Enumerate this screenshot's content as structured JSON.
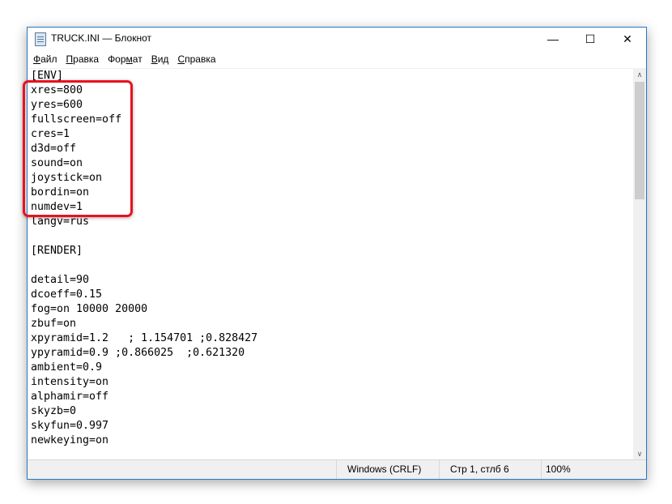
{
  "window": {
    "title": "TRUCK.INI — Блокнот",
    "icon": "notepad-icon"
  },
  "controls": {
    "minimize": "—",
    "maximize": "☐",
    "close": "✕"
  },
  "menu": [
    {
      "u": "Ф",
      "rest": "айл"
    },
    {
      "u": "П",
      "rest": "равка"
    },
    {
      "pre": "Фор",
      "u": "м",
      "rest": "ат"
    },
    {
      "u": "В",
      "rest": "ид"
    },
    {
      "u": "С",
      "rest": "правка"
    }
  ],
  "lines": [
    "[ENV]",
    "xres=800",
    "yres=600",
    "fullscreen=off",
    "cres=1",
    "d3d=off",
    "sound=on",
    "joystick=on",
    "bordin=on",
    "numdev=1",
    "langv=rus",
    "",
    "[RENDER]",
    "",
    "detail=90",
    "dcoeff=0.15",
    "fog=on 10000 20000",
    "zbuf=on",
    "xpyramid=1.2   ; 1.154701 ;0.828427",
    "ypyramid=0.9 ;0.866025  ;0.621320",
    "ambient=0.9",
    "intensity=on",
    "alphamir=off",
    "skyzb=0",
    "skyfun=0.997",
    "newkeying=on"
  ],
  "status": {
    "eol": "Windows (CRLF)",
    "position": "Стр 1, стлб 6",
    "zoom": "100%"
  },
  "highlight_color": "#e8121e"
}
